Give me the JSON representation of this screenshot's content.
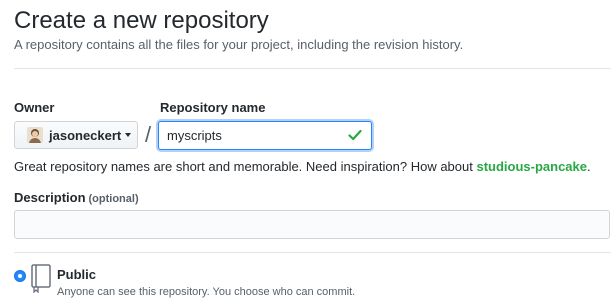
{
  "header": {
    "title": "Create a new repository",
    "subtitle": "A repository contains all the files for your project, including the revision history."
  },
  "owner": {
    "label": "Owner",
    "value": "jasoneckert"
  },
  "separator": "/",
  "repository": {
    "label": "Repository name",
    "value": "myscripts"
  },
  "name_hint": {
    "text": "Great repository names are short and memorable. Need inspiration? How about ",
    "suggestion": "studious-pancake",
    "suffix": "."
  },
  "description": {
    "label": "Description",
    "optional": "(optional)",
    "value": ""
  },
  "visibility": {
    "selected": "public",
    "public_label": "Public",
    "public_desc": "Anyone can see this repository. You choose who can commit."
  },
  "colors": {
    "accent": "#2188ff",
    "success": "#28a745",
    "text": "#24292e",
    "muted": "#586069"
  },
  "icons": {
    "owner_avatar": "avatar",
    "owner_dropdown": "caret-down-icon",
    "valid": "check-icon",
    "public": "repo-book-icon"
  }
}
